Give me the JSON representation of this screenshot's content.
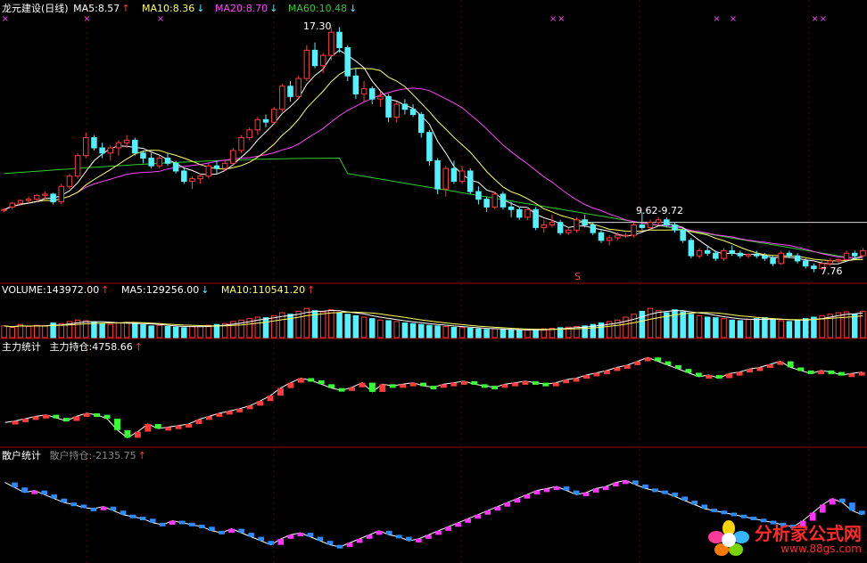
{
  "colors": {
    "up": "#ff3b3b",
    "down": "#54f1ff",
    "ma5": "#ffffff",
    "ma10": "#ffff66",
    "ma20": "#ff44ff",
    "ma60": "#33cc33",
    "grid": "#7a0000",
    "zg_down": "#33ff33",
    "sh_up": "#ff33ff",
    "sh_down": "#2a8cff"
  },
  "price_panel": {
    "title": "龙元建设(日线)",
    "ma5": "MA5:8.57",
    "ma5_arrow": "↑",
    "ma10": "MA10:8.36",
    "ma10_arrow": "↓",
    "ma20": "MA20:8.70",
    "ma20_arrow": "↓",
    "ma60": "MA60:10.48",
    "ma60_arrow": "↓",
    "high_label": "17.30",
    "low_label": "7.76",
    "range_label": "9.62-9.72",
    "signal_label": "S"
  },
  "volume_panel": {
    "vol": "VOLUME:143972.00",
    "vol_arrow": "↑",
    "ma5": "MA5:129256.00",
    "ma5_arrow": "↓",
    "ma10": "MA10:110541.20",
    "ma10_arrow": "↑"
  },
  "main_force_panel": {
    "name": "主力统计",
    "label": "主力持仓:4758.66",
    "arrow": "↑"
  },
  "retail_panel": {
    "name": "散户统计",
    "label": "散户持仓:-2135.75",
    "arrow": "↑"
  },
  "watermark": {
    "title": "分析家公式网",
    "url": "www.88gs.com"
  },
  "chart_data": [
    {
      "type": "candlestick",
      "title": "龙元建设(日线)",
      "series": [
        {
          "name": "MA5"
        },
        {
          "name": "MA10"
        },
        {
          "name": "MA20"
        },
        {
          "name": "MA60"
        }
      ],
      "ohlc": [
        [
          10.2,
          10.25,
          10.1,
          10.2
        ],
        [
          10.3,
          10.5,
          10.2,
          10.45
        ],
        [
          10.45,
          10.6,
          10.35,
          10.55
        ],
        [
          10.55,
          10.7,
          10.45,
          10.6
        ],
        [
          10.6,
          10.8,
          10.5,
          10.75
        ],
        [
          10.75,
          10.9,
          10.6,
          10.8
        ],
        [
          10.8,
          10.85,
          10.4,
          10.5
        ],
        [
          10.5,
          11.2,
          10.4,
          11.1
        ],
        [
          11.1,
          11.6,
          11,
          11.5
        ],
        [
          11.5,
          12.4,
          11.4,
          12.3
        ],
        [
          12.3,
          13.2,
          12.2,
          13
        ],
        [
          13,
          13.1,
          12.5,
          12.6
        ],
        [
          12.6,
          12.8,
          12.2,
          12.4
        ],
        [
          12.4,
          12.7,
          12.1,
          12.6
        ],
        [
          12.6,
          12.9,
          12.3,
          12.8
        ],
        [
          12.8,
          13.1,
          12.6,
          12.9
        ],
        [
          12.9,
          13,
          12.3,
          12.4
        ],
        [
          12.4,
          12.5,
          12,
          12.2
        ],
        [
          12.2,
          12.4,
          11.8,
          11.9
        ],
        [
          11.9,
          12.3,
          11.8,
          12.2
        ],
        [
          12.2,
          12.4,
          11.9,
          12
        ],
        [
          12,
          12.1,
          11.6,
          11.7
        ],
        [
          11.7,
          11.8,
          11.2,
          11.3
        ],
        [
          11.3,
          11.5,
          11,
          11.4
        ],
        [
          11.4,
          11.6,
          11.2,
          11.5
        ],
        [
          11.5,
          12,
          11.4,
          11.9
        ],
        [
          11.9,
          12.1,
          11.6,
          11.8
        ],
        [
          11.8,
          12.1,
          11.7,
          12
        ],
        [
          12,
          12.6,
          11.9,
          12.5
        ],
        [
          12.5,
          13.1,
          12.4,
          13
        ],
        [
          13,
          13.4,
          12.9,
          13.3
        ],
        [
          13.3,
          13.8,
          13.1,
          13.7
        ],
        [
          13.7,
          13.9,
          13.4,
          13.6
        ],
        [
          13.6,
          14.2,
          13.5,
          14.1
        ],
        [
          14.1,
          15.1,
          14,
          15
        ],
        [
          15,
          15.2,
          14.4,
          14.6
        ],
        [
          14.6,
          15.4,
          14.5,
          15.3
        ],
        [
          15.3,
          16.6,
          15.2,
          16.4
        ],
        [
          16.4,
          16.7,
          15.7,
          15.8
        ],
        [
          15.8,
          16.3,
          15.5,
          16.2
        ],
        [
          16.2,
          17.3,
          16,
          17.1
        ],
        [
          17.1,
          17.3,
          16.3,
          16.5
        ],
        [
          16.5,
          16.6,
          15.2,
          15.4
        ],
        [
          15.4,
          15.7,
          14.5,
          14.7
        ],
        [
          14.7,
          15.2,
          14.4,
          14.9
        ],
        [
          14.9,
          15,
          14.3,
          14.5
        ],
        [
          14.5,
          14.8,
          14.2,
          14.6
        ],
        [
          14.6,
          14.7,
          13.6,
          13.8
        ],
        [
          13.8,
          14.4,
          13.6,
          14.3
        ],
        [
          14.3,
          14.5,
          13.9,
          14.1
        ],
        [
          14.1,
          14.3,
          13.8,
          13.9
        ],
        [
          13.9,
          14,
          13,
          13.2
        ],
        [
          13.2,
          13.3,
          11.9,
          12.1
        ],
        [
          12.1,
          12.2,
          10.8,
          11
        ],
        [
          11,
          11.9,
          10.7,
          11.8
        ],
        [
          11.8,
          12.1,
          11.2,
          11.3
        ],
        [
          11.3,
          11.9,
          11.2,
          11.7
        ],
        [
          11.7,
          11.8,
          10.8,
          10.9
        ],
        [
          10.9,
          11.1,
          10.4,
          10.6
        ],
        [
          10.6,
          10.7,
          10.1,
          10.3
        ],
        [
          10.3,
          10.9,
          10.2,
          10.8
        ],
        [
          10.8,
          10.9,
          10.2,
          10.3
        ],
        [
          10.3,
          10.5,
          9.9,
          10.2
        ],
        [
          10.2,
          10.3,
          9.8,
          9.9
        ],
        [
          9.9,
          10.3,
          9.8,
          10.2
        ],
        [
          10.2,
          10.3,
          9.4,
          9.5
        ],
        [
          9.5,
          9.8,
          9.3,
          9.6
        ],
        [
          9.6,
          10,
          9.5,
          9.7
        ],
        [
          9.7,
          9.8,
          9.2,
          9.3
        ],
        [
          9.3,
          9.5,
          9.2,
          9.4
        ],
        [
          9.4,
          9.9,
          9.3,
          9.8
        ],
        [
          9.8,
          10,
          9.5,
          9.6
        ],
        [
          9.6,
          9.7,
          9.2,
          9.3
        ],
        [
          9.3,
          9.4,
          8.9,
          9
        ],
        [
          9,
          9.2,
          8.8,
          9.1
        ],
        [
          9.1,
          9.3,
          9,
          9.2
        ],
        [
          9.2,
          9.3,
          9.1,
          9.2
        ],
        [
          9.2,
          9.7,
          9.1,
          9.6
        ],
        [
          9.6,
          10.1,
          9.4,
          9.5
        ],
        [
          9.5,
          9.8,
          9.4,
          9.7
        ],
        [
          9.7,
          9.9,
          9.6,
          9.8
        ],
        [
          9.8,
          9.9,
          9.5,
          9.6
        ],
        [
          9.6,
          9.7,
          9.3,
          9.4
        ],
        [
          9.4,
          9.5,
          8.9,
          9
        ],
        [
          9,
          9.1,
          8.3,
          8.4
        ],
        [
          8.4,
          8.7,
          8.3,
          8.6
        ],
        [
          8.6,
          8.8,
          8.4,
          8.5
        ],
        [
          8.5,
          8.6,
          8.2,
          8.3
        ],
        [
          8.3,
          8.7,
          8.2,
          8.6
        ],
        [
          8.6,
          8.8,
          8.4,
          8.5
        ],
        [
          8.5,
          8.6,
          8.3,
          8.4
        ],
        [
          8.4,
          8.5,
          8.3,
          8.45
        ],
        [
          8.45,
          8.6,
          8.3,
          8.4
        ],
        [
          8.4,
          8.5,
          8.2,
          8.3
        ],
        [
          8.3,
          8.4,
          8,
          8.1
        ],
        [
          8.1,
          8.6,
          8.05,
          8.5
        ],
        [
          8.5,
          8.6,
          8.3,
          8.4
        ],
        [
          8.4,
          8.5,
          8.1,
          8.2
        ],
        [
          8.2,
          8.3,
          7.9,
          8
        ],
        [
          8,
          8.1,
          7.76,
          7.9
        ],
        [
          7.9,
          8.2,
          7.85,
          8.1
        ],
        [
          8.1,
          8.3,
          8,
          8.2
        ],
        [
          8.2,
          8.3,
          8.1,
          8.25
        ],
        [
          8.25,
          8.6,
          8.2,
          8.5
        ],
        [
          8.5,
          8.6,
          8.3,
          8.4
        ],
        [
          8.4,
          8.7,
          8.35,
          8.6
        ]
      ],
      "markers_x_top": [
        0,
        10,
        19,
        67,
        68,
        87,
        89,
        99,
        100
      ],
      "ylim": [
        7.4,
        17.8
      ]
    },
    {
      "type": "bar",
      "title": "VOLUME",
      "values": [
        40,
        35,
        45,
        38,
        42,
        40,
        50,
        48,
        55,
        60,
        58,
        52,
        48,
        45,
        50,
        52,
        48,
        44,
        40,
        42,
        38,
        36,
        34,
        38,
        40,
        42,
        45,
        48,
        55,
        60,
        65,
        70,
        68,
        75,
        85,
        80,
        90,
        100,
        92,
        88,
        95,
        85,
        80,
        75,
        70,
        65,
        60,
        58,
        55,
        50,
        48,
        45,
        42,
        40,
        38,
        35,
        34,
        32,
        30,
        28,
        30,
        28,
        26,
        24,
        26,
        28,
        30,
        32,
        34,
        36,
        38,
        40,
        45,
        50,
        55,
        60,
        70,
        80,
        90,
        100,
        92,
        85,
        95,
        88,
        80,
        75,
        70,
        68,
        65,
        60,
        58,
        62,
        65,
        68,
        60,
        58,
        55,
        60,
        65,
        70,
        75,
        80,
        85,
        88,
        80,
        90
      ],
      "series": [
        {
          "name": "MA5"
        },
        {
          "name": "MA10"
        }
      ],
      "ylim": [
        0,
        140
      ]
    },
    {
      "type": "bar",
      "title": "主力统计",
      "series": [
        {
          "name": "主力持仓"
        }
      ],
      "values": [
        20,
        22,
        25,
        28,
        30,
        26,
        22,
        28,
        32,
        30,
        25,
        10,
        0,
        8,
        18,
        12,
        14,
        16,
        18,
        24,
        28,
        32,
        35,
        38,
        42,
        48,
        55,
        65,
        72,
        78,
        75,
        70,
        65,
        62,
        66,
        72,
        60,
        70,
        68,
        70,
        72,
        68,
        66,
        70,
        72,
        74,
        70,
        68,
        66,
        70,
        72,
        74,
        72,
        70,
        72,
        76,
        78,
        82,
        85,
        88,
        92,
        95,
        100,
        105,
        100,
        95,
        90,
        85,
        80,
        82,
        78,
        84,
        86,
        90,
        92,
        96,
        100,
        92,
        88,
        84,
        88,
        86,
        82,
        84,
        86
      ],
      "ylim": [
        -10,
        110
      ]
    },
    {
      "type": "bar",
      "title": "散户统计",
      "series": [
        {
          "name": "散户持仓"
        }
      ],
      "values": [
        80,
        75,
        70,
        72,
        68,
        64,
        60,
        58,
        55,
        54,
        56,
        52,
        48,
        46,
        44,
        40,
        38,
        42,
        40,
        38,
        36,
        32,
        30,
        34,
        30,
        26,
        22,
        18,
        24,
        28,
        30,
        26,
        22,
        18,
        16,
        20,
        24,
        28,
        32,
        28,
        26,
        22,
        24,
        28,
        32,
        36,
        40,
        44,
        48,
        52,
        56,
        60,
        64,
        68,
        72,
        74,
        76,
        72,
        68,
        70,
        74,
        76,
        80,
        82,
        78,
        74,
        72,
        70,
        66,
        62,
        58,
        54,
        52,
        50,
        48,
        46,
        44,
        42,
        40,
        38,
        36,
        42,
        50,
        58,
        64,
        60,
        52,
        48
      ],
      "ylim": [
        0,
        100
      ]
    }
  ]
}
